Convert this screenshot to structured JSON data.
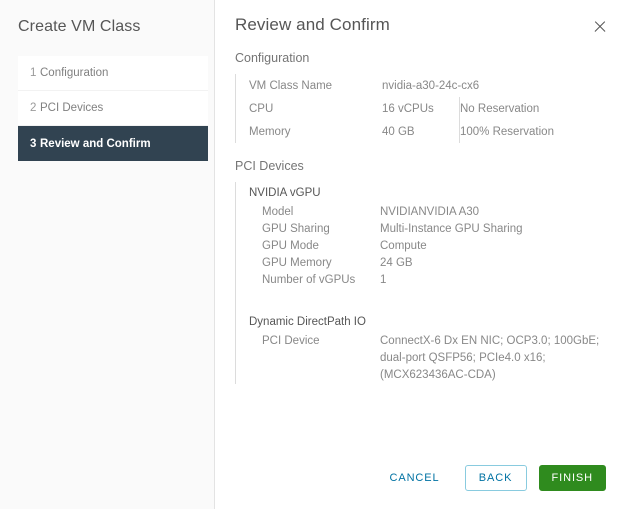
{
  "sidebar": {
    "title": "Create VM Class",
    "steps": [
      {
        "num": "1",
        "label": "Configuration",
        "active": false
      },
      {
        "num": "2",
        "label": "PCI Devices",
        "active": false
      },
      {
        "num": "3",
        "label": "Review and Confirm",
        "active": true
      }
    ]
  },
  "header": {
    "title": "Review and Confirm",
    "close_icon": "close-icon"
  },
  "configuration": {
    "section_title": "Configuration",
    "rows": [
      {
        "key": "VM Class Name",
        "value1": "nvidia-a30-24c-cx6",
        "value2": ""
      },
      {
        "key": "CPU",
        "value1": "16 vCPUs",
        "value2": "No Reservation"
      },
      {
        "key": "Memory",
        "value1": "40 GB",
        "value2": "100% Reservation"
      }
    ]
  },
  "pci_devices": {
    "section_title": "PCI Devices",
    "groups": [
      {
        "title": "NVIDIA vGPU",
        "rows": [
          {
            "key": "Model",
            "value": "NVIDIANVIDIA A30"
          },
          {
            "key": "GPU Sharing",
            "value": "Multi-Instance GPU Sharing"
          },
          {
            "key": "GPU Mode",
            "value": "Compute"
          },
          {
            "key": "GPU Memory",
            "value": "24 GB"
          },
          {
            "key": "Number of vGPUs",
            "value": "1"
          }
        ]
      },
      {
        "title": "Dynamic DirectPath IO",
        "rows": [
          {
            "key": "PCI Device",
            "value": "ConnectX-6 Dx EN NIC; OCP3.0; 100GbE; dual-port QSFP56; PCIe4.0 x16; (MCX623436AC-CDA)"
          }
        ]
      }
    ]
  },
  "footer": {
    "cancel_label": "CANCEL",
    "back_label": "BACK",
    "finish_label": "FINISH"
  },
  "colors": {
    "accent_green": "#60b515",
    "primary_green": "#2f8b1e",
    "link_blue": "#0072a3",
    "active_step_bg": "#314351",
    "sidebar_bg": "#fafafa"
  }
}
